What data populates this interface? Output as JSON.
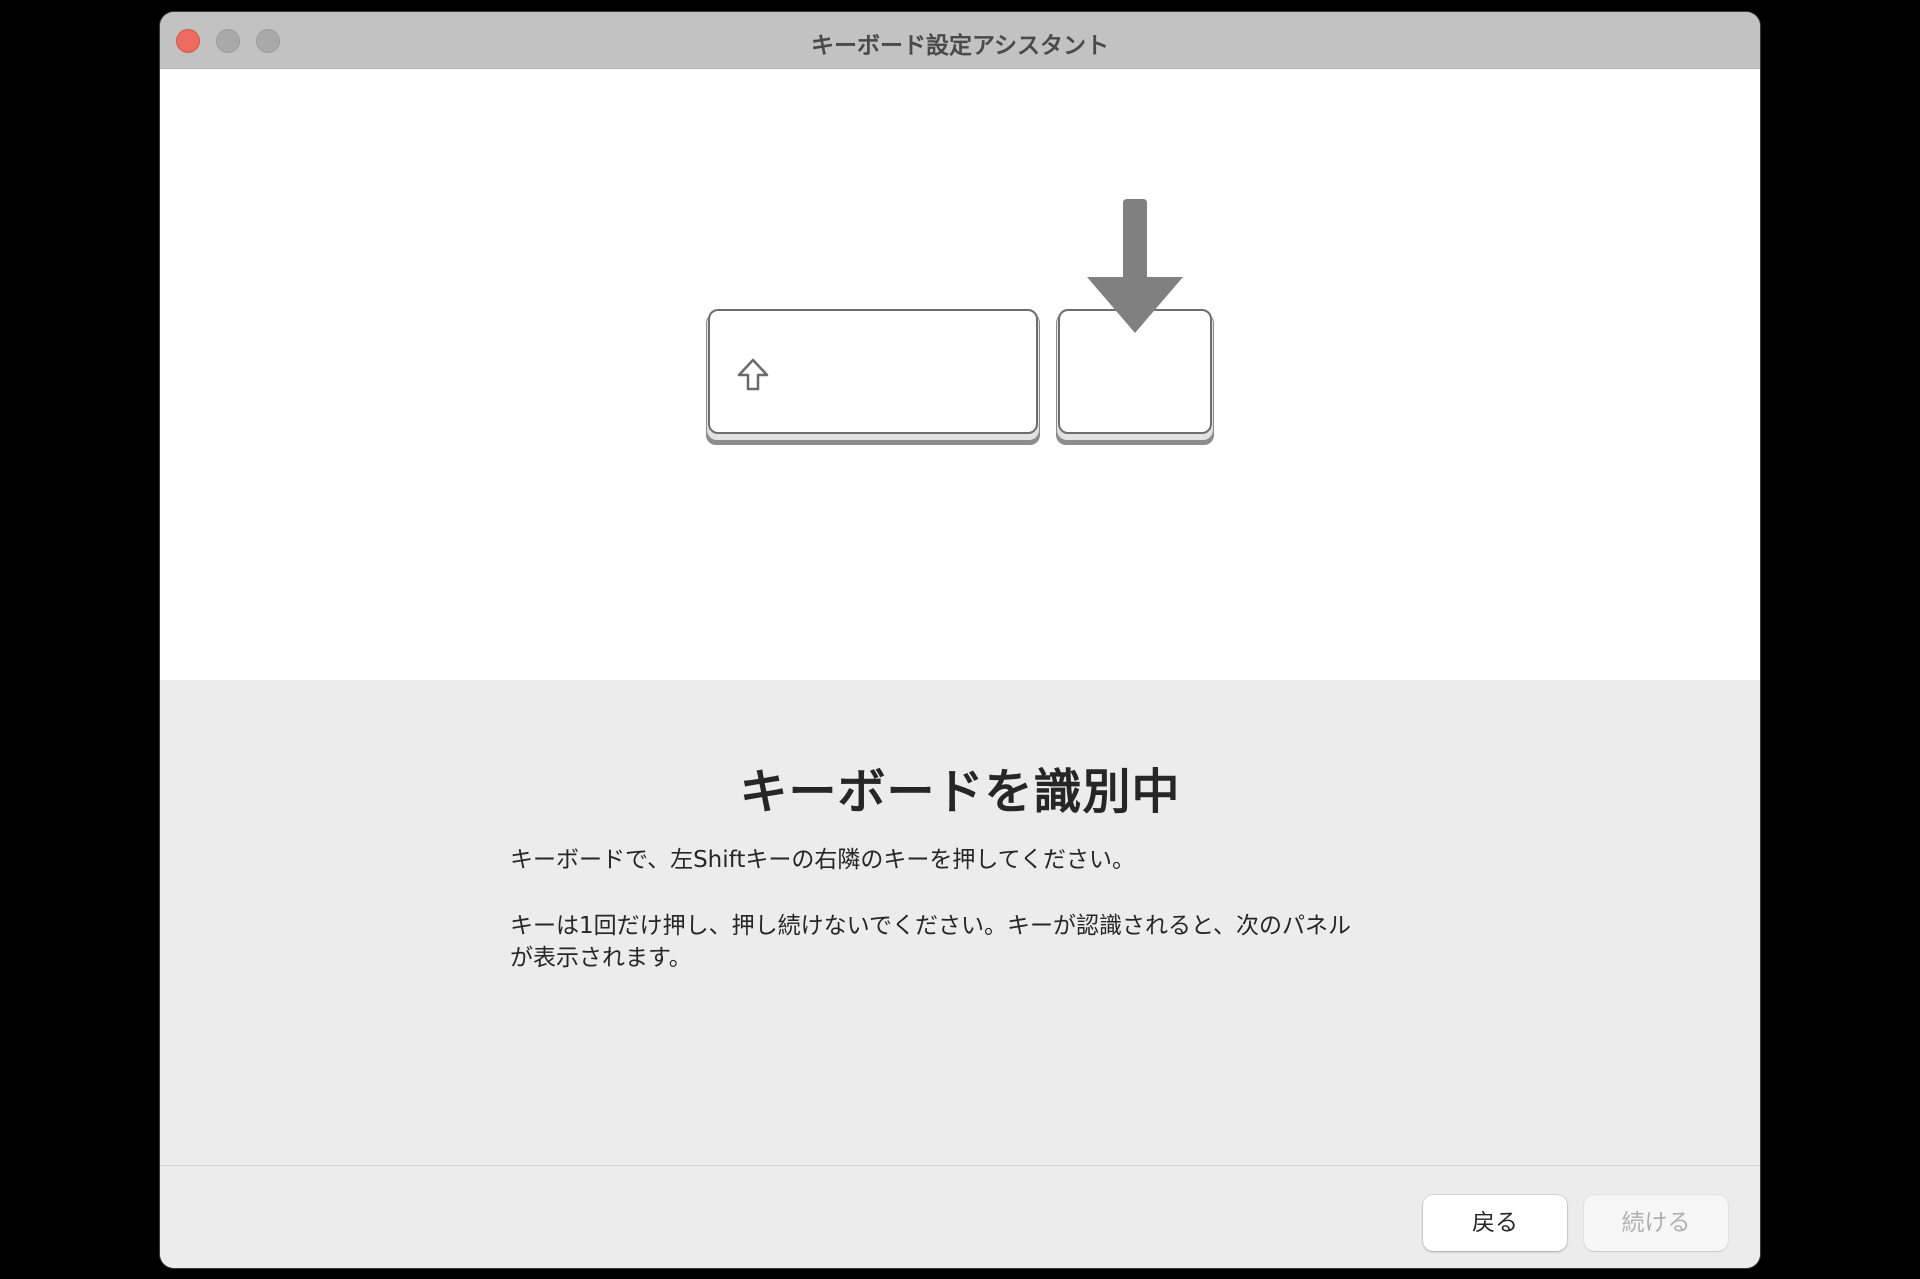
{
  "window": {
    "title": "キーボード設定アシスタント"
  },
  "illustration": {
    "left_key_icon": "shift-arrow-icon",
    "indicator_icon": "down-arrow-icon"
  },
  "content": {
    "heading": "キーボードを識別中",
    "instruction": "キーボードで、左Shiftキーの右隣のキーを押してください。",
    "note_line1": "キーは1回だけ押し、押し続けないでください。キーが認識されると、次のパネル",
    "note_line2": "が表示されます。"
  },
  "footer": {
    "back_label": "戻る",
    "continue_label": "続ける"
  },
  "colors": {
    "close_button": "#ec6a5e",
    "titlebar": "#c2c2c2",
    "pane_background": "#ececec",
    "arrow": "#808080"
  }
}
